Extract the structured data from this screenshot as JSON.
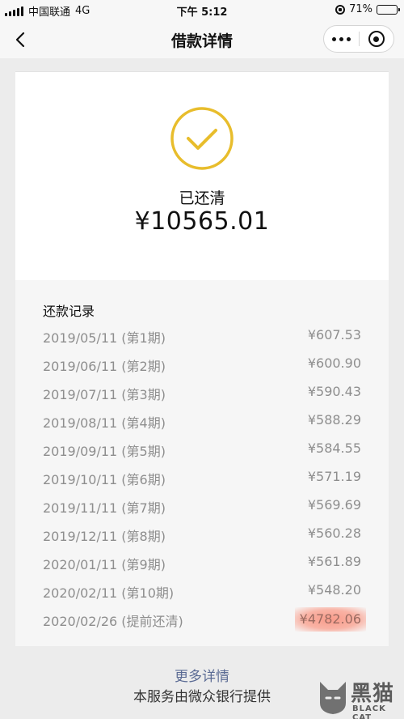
{
  "status_bar": {
    "carrier": "中国联通",
    "network": "4G",
    "time": "下午 5:12",
    "battery": "71%",
    "battery_level": 0.71
  },
  "nav": {
    "title": "借款详情"
  },
  "summary": {
    "status": "已还清",
    "amount": "¥10565.01"
  },
  "records": {
    "title": "还款记录",
    "rows": [
      {
        "date": "2019/05/11 (第1期)",
        "amount": "¥607.53"
      },
      {
        "date": "2019/06/11 (第2期)",
        "amount": "¥600.90"
      },
      {
        "date": "2019/07/11 (第3期)",
        "amount": "¥590.43"
      },
      {
        "date": "2019/08/11 (第4期)",
        "amount": "¥588.29"
      },
      {
        "date": "2019/09/11 (第5期)",
        "amount": "¥584.55"
      },
      {
        "date": "2019/10/11 (第6期)",
        "amount": "¥571.19"
      },
      {
        "date": "2019/11/11 (第7期)",
        "amount": "¥569.69"
      },
      {
        "date": "2019/12/11 (第8期)",
        "amount": "¥560.28"
      },
      {
        "date": "2020/01/11 (第9期)",
        "amount": "¥561.89"
      },
      {
        "date": "2020/02/11 (第10期)",
        "amount": "¥548.20"
      },
      {
        "date": "2020/02/26 (提前还清)",
        "amount": "¥4782.06"
      }
    ]
  },
  "footer": {
    "more_link": "更多详情",
    "provider": "本服务由微众银行提供"
  },
  "watermark": {
    "text": "黑猫",
    "sub": "BLACK CAT"
  },
  "colors": {
    "accent_gold": "#e8bd2c",
    "link": "#5b6b94",
    "highlight": "#f8907a"
  }
}
